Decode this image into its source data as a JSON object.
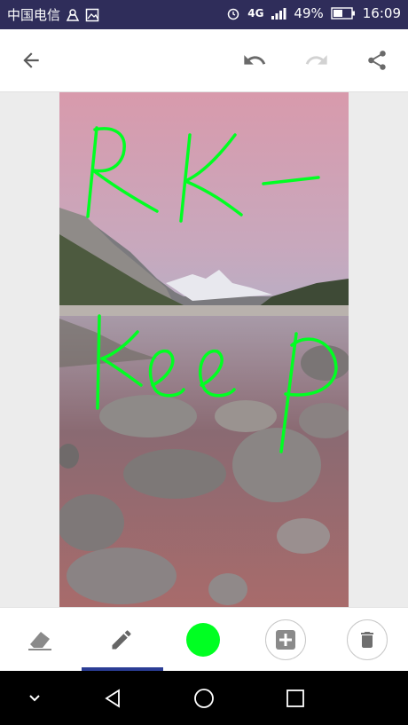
{
  "status_bar": {
    "carrier": "中国电信",
    "network": "4G",
    "battery_percent": "49%",
    "time": "16:09"
  },
  "app_bar": {
    "icons": [
      "back-arrow-icon",
      "undo-icon",
      "redo-icon",
      "share-icon"
    ],
    "redo_enabled": false
  },
  "canvas": {
    "handwriting_lines": [
      "RK-",
      "keep"
    ],
    "ink_color": "#00ff22"
  },
  "toolbar": {
    "tools": [
      "eraser-icon",
      "pen-icon"
    ],
    "active_tool": "pen",
    "selected_color": "#00ff22",
    "actions": [
      "add-icon",
      "delete-icon"
    ]
  },
  "colors": {
    "status_bar": "#2f2d5a",
    "accent": "#2b3d95",
    "canvas_background": "#ececec"
  }
}
